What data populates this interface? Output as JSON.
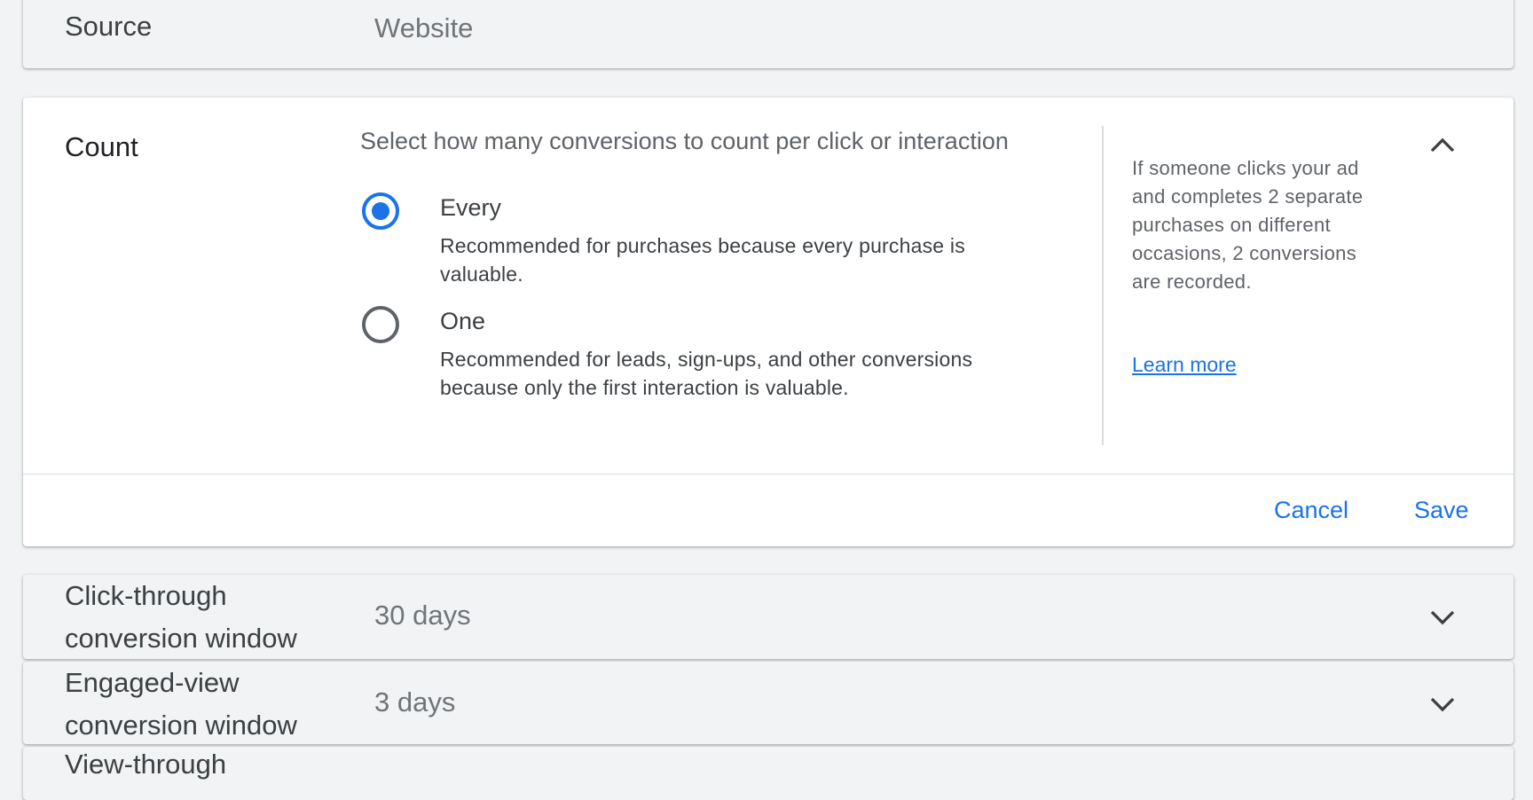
{
  "source": {
    "label": "Source",
    "value": "Website"
  },
  "count": {
    "label": "Count",
    "prompt": "Select how many conversions to count per click or interaction",
    "options": [
      {
        "title": "Every",
        "description": "Recommended for purchases because every purchase is valuable.",
        "selected": true
      },
      {
        "title": "One",
        "description": "Recommended for leads, sign-ups, and other conversions because only the first interaction is valuable.",
        "selected": false
      }
    ],
    "help_text": "If someone clicks your ad and completes 2 separate purchases on different occasions, 2 conversions are recorded.",
    "learn_more": "Learn more",
    "cancel_label": "Cancel",
    "save_label": "Save",
    "collapse_icon": "chevron-up-icon"
  },
  "click_through": {
    "label_line1": "Click-through",
    "label_line2": "conversion window",
    "value": "30 days",
    "expand_icon": "chevron-down-icon"
  },
  "engaged_view": {
    "label_line1": "Engaged-view",
    "label_line2": "conversion window",
    "value": "3 days",
    "expand_icon": "chevron-down-icon"
  },
  "view_through": {
    "label_line1": "View-through"
  },
  "colors": {
    "accent": "#1a73e8",
    "background": "#f1f3f4",
    "card_expanded": "#ffffff",
    "text_secondary": "#5f6368"
  }
}
